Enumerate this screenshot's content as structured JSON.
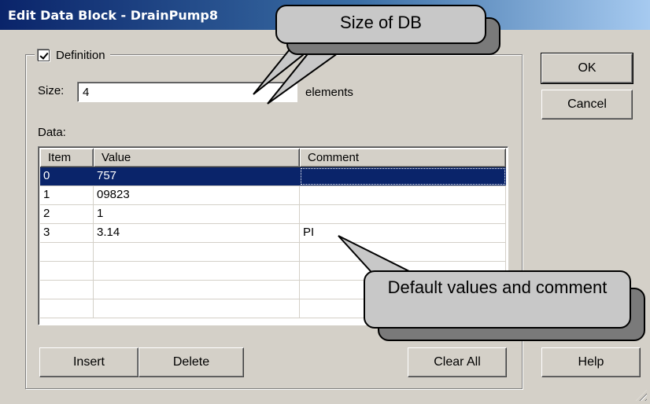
{
  "window": {
    "title": "Edit Data Block - DrainPump8"
  },
  "definition": {
    "checkbox_label": "Definition",
    "checked": true
  },
  "size": {
    "label": "Size:",
    "value": "4",
    "units": "elements"
  },
  "data_label": "Data:",
  "table": {
    "columns": [
      "Item",
      "Value",
      "Comment"
    ],
    "rows": [
      {
        "item": "0",
        "value": "757",
        "comment": ""
      },
      {
        "item": "1",
        "value": "09823",
        "comment": ""
      },
      {
        "item": "2",
        "value": "1",
        "comment": ""
      },
      {
        "item": "3",
        "value": "3.14",
        "comment": "PI"
      }
    ],
    "selected_row": 0
  },
  "buttons": {
    "ok": "OK",
    "cancel": "Cancel",
    "insert": "Insert",
    "delete": "Delete",
    "clear_all": "Clear All",
    "help": "Help"
  },
  "callouts": {
    "size": "Size of DB",
    "defaults": "Default values and comment"
  }
}
